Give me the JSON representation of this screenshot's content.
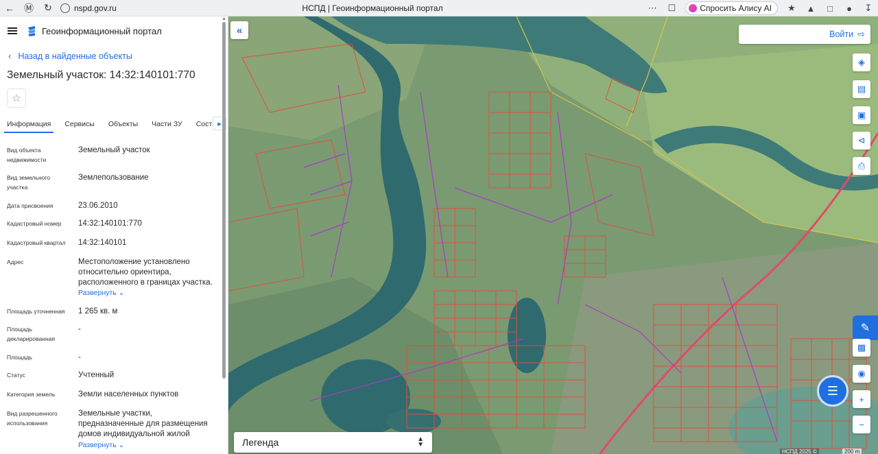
{
  "browser": {
    "url": "nspd.gov.ru",
    "tab_title": "НСПД | Геоинформационный портал",
    "alice_label": "Спросить Алису AI"
  },
  "header": {
    "portal_title": "Геоинформационный портал"
  },
  "panel": {
    "back_link": "Назад в найденные объекты",
    "parcel_title": "Земельный участок: 14:32:140101:770",
    "tabs": [
      {
        "label": "Информация",
        "active": true
      },
      {
        "label": "Сервисы",
        "active": false
      },
      {
        "label": "Объекты",
        "active": false
      },
      {
        "label": "Части ЗУ",
        "active": false
      },
      {
        "label": "Соста",
        "active": false
      }
    ],
    "expand_label": "Развернуть",
    "fields": [
      {
        "label": "Вид объекта недвижимости",
        "value": "Земельный участок"
      },
      {
        "label": "Вид земельного участка",
        "value": "Землепользование"
      },
      {
        "label": "Дата присвоения",
        "value": "23.06.2010"
      },
      {
        "label": "Кадастровый номер",
        "value": "14:32:140101:770"
      },
      {
        "label": "Кадастровый квартал",
        "value": "14:32:140101"
      },
      {
        "label": "Адрес",
        "value": "Местоположение установлено относительно ориентира, расположенного в границах участка."
      },
      {
        "label": "Площадь уточненная",
        "value": "1 265 кв. м"
      },
      {
        "label": "Площадь декларированная",
        "value": "-"
      },
      {
        "label": "Площадь",
        "value": "-"
      },
      {
        "label": "Статус",
        "value": "Учтенный"
      },
      {
        "label": "Категория земель",
        "value": "Земли населенных пунктов"
      },
      {
        "label": "Вид разрешенного использования",
        "value": "Земельные участки, предназначенные для размещения домов индивидуальной жилой"
      }
    ]
  },
  "map": {
    "login_label": "Войти",
    "legend_label": "Легенда",
    "attribution": "НСПД 2025 ©",
    "scale_label": "200 m"
  },
  "colors": {
    "accent": "#1f6fe0",
    "parcel_line": "#e0503a",
    "zone_line": "#a83cc4",
    "water": "#2f6a6e"
  }
}
